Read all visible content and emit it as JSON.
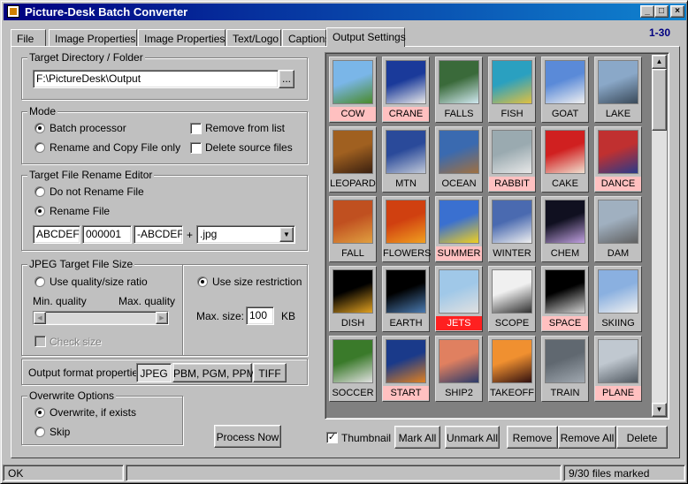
{
  "window": {
    "title": "Picture-Desk Batch Converter",
    "minimize": "_",
    "maximize": "□",
    "close": "×"
  },
  "tabs": [
    "File",
    "Image Properties 1",
    "Image Properties 2",
    "Text/Logo",
    "Captions",
    "Output Settings"
  ],
  "range_indicator": "1-30",
  "target_dir": {
    "label": "Target Directory / Folder",
    "value": "F:\\PictureDesk\\Output",
    "browse": "..."
  },
  "mode": {
    "label": "Mode",
    "batch": "Batch processor",
    "rename_copy": "Rename and Copy File only",
    "remove_from_list": "Remove from list",
    "delete_source": "Delete source files",
    "selected": "batch"
  },
  "rename": {
    "label": "Target File Rename Editor",
    "no_rename": "Do not Rename File",
    "rename_file": "Rename File",
    "prefix": "ABCDEF-",
    "counter": "000001",
    "suffix": "-ABCDEF",
    "plus": "+",
    "ext": ".jpg"
  },
  "jpeg": {
    "label": "JPEG Target File Size",
    "quality_ratio": "Use quality/size ratio",
    "min_quality": "Min. quality",
    "max_quality": "Max. quality",
    "check_size": "Check size",
    "use_size": "Use size restriction",
    "max_size_label": "Max. size:",
    "max_size_value": "100",
    "unit": "KB"
  },
  "output_format": {
    "label": "Output format properties:",
    "buttons": [
      "JPEG",
      "PBM, PGM, PPM",
      "TIFF"
    ]
  },
  "overwrite": {
    "label": "Overwrite Options",
    "overwrite": "Overwrite, if exists",
    "skip": "Skip"
  },
  "process_now": "Process Now",
  "thumbnails": [
    {
      "name": "COW",
      "state": "marked",
      "colors": [
        "#7ab6e8",
        "#4a8a2a"
      ]
    },
    {
      "name": "CRANE",
      "state": "marked",
      "colors": [
        "#1a3a9a",
        "#e8e8e8"
      ]
    },
    {
      "name": "FALLS",
      "state": "normal",
      "colors": [
        "#3a6a3a",
        "#d0e8f0"
      ]
    },
    {
      "name": "FISH",
      "state": "normal",
      "colors": [
        "#2aa0c0",
        "#e0c040"
      ]
    },
    {
      "name": "GOAT",
      "state": "normal",
      "colors": [
        "#5a8ad8",
        "#f0f0f0"
      ]
    },
    {
      "name": "LAKE",
      "state": "normal",
      "colors": [
        "#8aa8c8",
        "#3a4a5a"
      ]
    },
    {
      "name": "LEOPARD",
      "state": "normal",
      "colors": [
        "#a06020",
        "#3a2010"
      ]
    },
    {
      "name": "MTN",
      "state": "normal",
      "colors": [
        "#2a4a9a",
        "#c0c8d8"
      ]
    },
    {
      "name": "OCEAN",
      "state": "normal",
      "colors": [
        "#3a6ab0",
        "#a07040"
      ]
    },
    {
      "name": "RABBIT",
      "state": "marked",
      "colors": [
        "#9aaab0",
        "#e8e8e8"
      ]
    },
    {
      "name": "CAKE",
      "state": "normal",
      "colors": [
        "#d02020",
        "#f0e0d0"
      ]
    },
    {
      "name": "DANCE",
      "state": "marked",
      "colors": [
        "#c03030",
        "#2a3a8a"
      ]
    },
    {
      "name": "FALL",
      "state": "normal",
      "colors": [
        "#c05020",
        "#e0a040"
      ]
    },
    {
      "name": "FLOWERS",
      "state": "normal",
      "colors": [
        "#d04010",
        "#f0a020"
      ]
    },
    {
      "name": "SUMMER",
      "state": "marked",
      "colors": [
        "#3a70d0",
        "#f0d020"
      ]
    },
    {
      "name": "WINTER",
      "state": "normal",
      "colors": [
        "#4a6ab0",
        "#f0f0f0"
      ]
    },
    {
      "name": "CHEM",
      "state": "normal",
      "colors": [
        "#101020",
        "#c0a0e0"
      ]
    },
    {
      "name": "DAM",
      "state": "normal",
      "colors": [
        "#a0b0c0",
        "#606060"
      ]
    },
    {
      "name": "DISH",
      "state": "normal",
      "colors": [
        "#000000",
        "#e0a020"
      ]
    },
    {
      "name": "EARTH",
      "state": "normal",
      "colors": [
        "#000000",
        "#4a7ab0"
      ]
    },
    {
      "name": "JETS",
      "state": "hot",
      "colors": [
        "#a0c8e8",
        "#e0e0e0"
      ]
    },
    {
      "name": "SCOPE",
      "state": "normal",
      "colors": [
        "#f0f0f0",
        "#303030"
      ]
    },
    {
      "name": "SPACE",
      "state": "marked",
      "colors": [
        "#000000",
        "#d0d0d0"
      ]
    },
    {
      "name": "SKIING",
      "state": "normal",
      "colors": [
        "#8ab0e0",
        "#f0f0f0"
      ]
    },
    {
      "name": "SOCCER",
      "state": "normal",
      "colors": [
        "#3a7a2a",
        "#e0e0e0"
      ]
    },
    {
      "name": "START",
      "state": "marked",
      "colors": [
        "#1a3a8a",
        "#e08020"
      ]
    },
    {
      "name": "SHIP2",
      "state": "normal",
      "colors": [
        "#e08060",
        "#2a3a6a"
      ]
    },
    {
      "name": "TAKEOFF",
      "state": "normal",
      "colors": [
        "#f09030",
        "#301010"
      ]
    },
    {
      "name": "TRAIN",
      "state": "normal",
      "colors": [
        "#606870",
        "#a0a8b0"
      ]
    },
    {
      "name": "PLANE",
      "state": "marked",
      "colors": [
        "#c0c8d0",
        "#505860"
      ]
    }
  ],
  "bottom": {
    "thumbnail": "Thumbnail",
    "mark_all": "Mark All",
    "unmark_all": "Unmark All",
    "remove": "Remove",
    "remove_all": "Remove All",
    "delete": "Delete"
  },
  "status": {
    "left": "OK",
    "middle": "",
    "right": "9/30 files marked"
  },
  "scroll": {
    "up": "▲",
    "down": "▼"
  }
}
